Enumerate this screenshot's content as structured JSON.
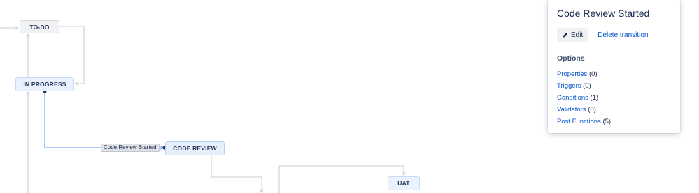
{
  "diagram": {
    "nodes": {
      "todo": "TO-DO",
      "in_progress": "IN PROGRESS",
      "code_review": "CODE REVIEW",
      "uat": "UAT"
    },
    "transition_label": "Code Review Started",
    "colors": {
      "edge": "#c8ccd2",
      "selected_edge": "#4c9aff",
      "endpoint": "#253858"
    }
  },
  "panel": {
    "title": "Code Review Started",
    "edit_label": "Edit",
    "delete_label": "Delete transition",
    "options_heading": "Options",
    "options": [
      {
        "label": "Properties",
        "count": "(0)"
      },
      {
        "label": "Triggers",
        "count": "(0)"
      },
      {
        "label": "Conditions",
        "count": "(1)"
      },
      {
        "label": "Validators",
        "count": "(0)"
      },
      {
        "label": "Post Functions",
        "count": "(5)"
      }
    ]
  }
}
